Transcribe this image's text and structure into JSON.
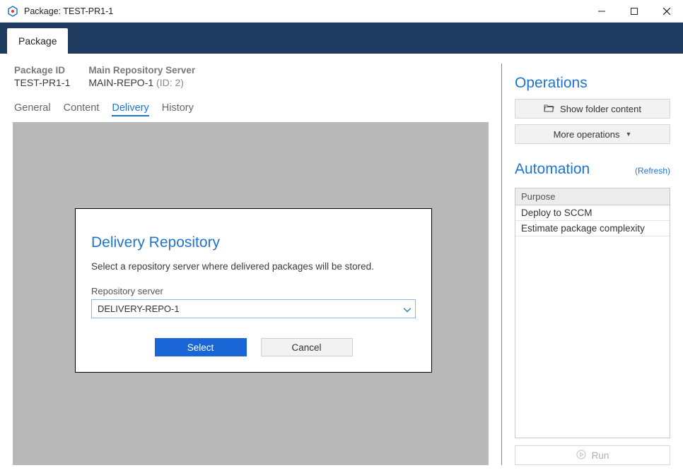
{
  "window": {
    "title": "Package: TEST-PR1-1"
  },
  "mainTab": {
    "label": "Package"
  },
  "header": {
    "packageIdLabel": "Package ID",
    "packageId": "TEST-PR1-1",
    "repoLabel": "Main Repository Server",
    "repoValue": "MAIN-REPO-1",
    "repoSub": "(ID: 2)"
  },
  "subtabs": {
    "general": "General",
    "content": "Content",
    "delivery": "Delivery",
    "history": "History"
  },
  "modal": {
    "title": "Delivery Repository",
    "desc": "Select a repository server where delivered packages will be stored.",
    "fieldLabel": "Repository server",
    "selectValue": "DELIVERY-REPO-1",
    "selectBtn": "Select",
    "cancelBtn": "Cancel"
  },
  "operations": {
    "title": "Operations",
    "showFolder": "Show folder content",
    "more": "More operations"
  },
  "automation": {
    "title": "Automation",
    "refresh": "(Refresh)",
    "header": "Purpose",
    "rows": [
      "Deploy to SCCM",
      "Estimate package complexity"
    ],
    "run": "Run"
  }
}
